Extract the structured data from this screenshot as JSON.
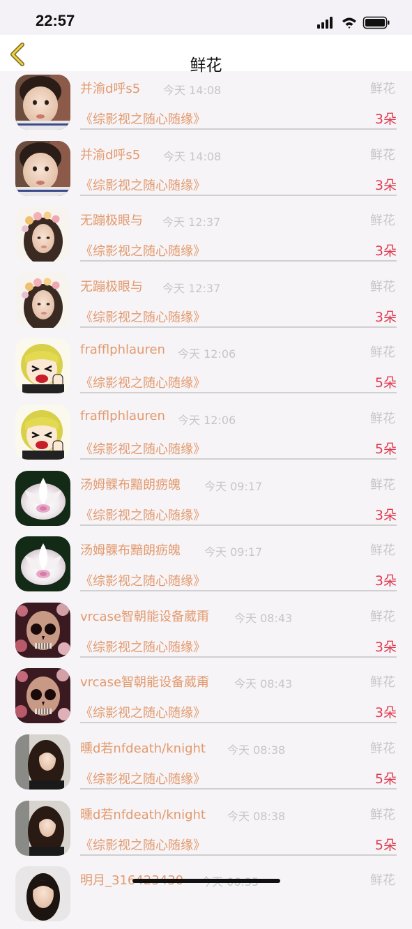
{
  "status_bar": {
    "time": "22:57",
    "icons": [
      "cellular-signal-icon",
      "wifi-icon",
      "battery-icon"
    ]
  },
  "nav": {
    "back_icon": "chevron-left-icon",
    "title": "鲜花"
  },
  "colors": {
    "accent": "#e39a6e",
    "count": "#e0394e",
    "muted": "#c6c6c6"
  },
  "rows": [
    {
      "name": "并渝d呼s5",
      "time": "今天 14:08",
      "gift": "鲜花",
      "work": "《综影视之随心随缘》",
      "count": "3朵",
      "avatar": "child-photo"
    },
    {
      "name": "并渝d呼s5",
      "time": "今天 14:08",
      "gift": "鲜花",
      "work": "《综影视之随心随缘》",
      "count": "3朵",
      "avatar": "child-photo"
    },
    {
      "name": "无蹦极眼与",
      "time": "今天 12:37",
      "gift": "鲜花",
      "work": "《综影视之随心随缘》",
      "count": "3朵",
      "avatar": "woman-flower-crown"
    },
    {
      "name": "无蹦极眼与",
      "time": "今天 12:37",
      "gift": "鲜花",
      "work": "《综影视之随心随缘》",
      "count": "3朵",
      "avatar": "woman-flower-crown"
    },
    {
      "name": "frafflphlauren",
      "time": "今天 12:06",
      "gift": "鲜花",
      "work": "《综影视之随心随缘》",
      "count": "5朵",
      "avatar": "cartoon-girl"
    },
    {
      "name": "frafflphlauren",
      "time": "今天 12:06",
      "gift": "鲜花",
      "work": "《综影视之随心随缘》",
      "count": "5朵",
      "avatar": "cartoon-girl"
    },
    {
      "name": "汤姆髁布黯朗疬魄",
      "time": "今天 09:17",
      "gift": "鲜花",
      "work": "《综影视之随心随缘》",
      "count": "3朵",
      "avatar": "white-lotus"
    },
    {
      "name": "汤姆髁布黯朗疬魄",
      "time": "今天 09:17",
      "gift": "鲜花",
      "work": "《综影视之随心随缘》",
      "count": "3朵",
      "avatar": "white-lotus"
    },
    {
      "name": "vrcase智朝能设备葳甭",
      "time": "今天 08:43",
      "gift": "鲜花",
      "work": "《综影视之随心随缘》",
      "count": "3朵",
      "avatar": "floral-skull"
    },
    {
      "name": "vrcase智朝能设备葳甭",
      "time": "今天 08:43",
      "gift": "鲜花",
      "work": "《综影视之随心随缘》",
      "count": "3朵",
      "avatar": "floral-skull"
    },
    {
      "name": "曛d若nfdeath/knight",
      "time": "今天 08:38",
      "gift": "鲜花",
      "work": "《综影视之随心随缘》",
      "count": "5朵",
      "avatar": "dark-hair-woman"
    },
    {
      "name": "曛d若nfdeath/knight",
      "time": "今天 08:38",
      "gift": "鲜花",
      "work": "《综影视之随心随缘》",
      "count": "5朵",
      "avatar": "dark-hair-woman"
    },
    {
      "name": "明月_316423430",
      "time": "今天 06:35",
      "gift": "鲜花",
      "work": "",
      "count": "",
      "avatar": "woman-portrait"
    }
  ]
}
